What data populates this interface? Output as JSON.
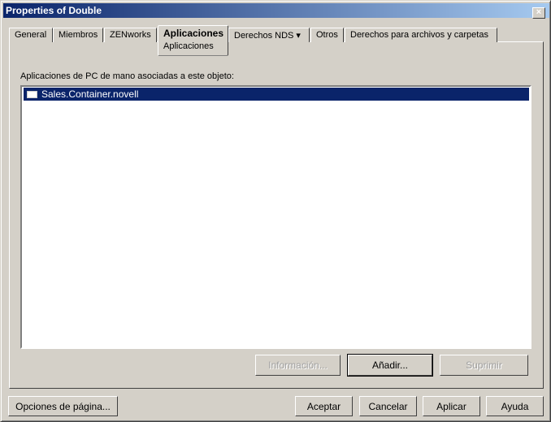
{
  "window": {
    "title": "Properties of Double",
    "close": "×"
  },
  "tabs": [
    {
      "label": "General"
    },
    {
      "label": "Miembros"
    },
    {
      "label": "ZENworks"
    },
    {
      "label": "Aplicaciones",
      "sub": "Aplicaciones"
    },
    {
      "label": "Derechos NDS ▾"
    },
    {
      "label": "Otros"
    },
    {
      "label": "Derechos para archivos y carpetas"
    }
  ],
  "main": {
    "list_label": "Aplicaciones de PC de mano asociadas a este objeto:",
    "items": [
      "Sales.Container.novell"
    ],
    "buttons": {
      "info": "Información...",
      "add": "Añadir...",
      "delete": "Suprimir"
    }
  },
  "footer": {
    "page_options": "Opciones de página...",
    "ok": "Aceptar",
    "cancel": "Cancelar",
    "apply": "Aplicar",
    "help": "Ayuda"
  }
}
